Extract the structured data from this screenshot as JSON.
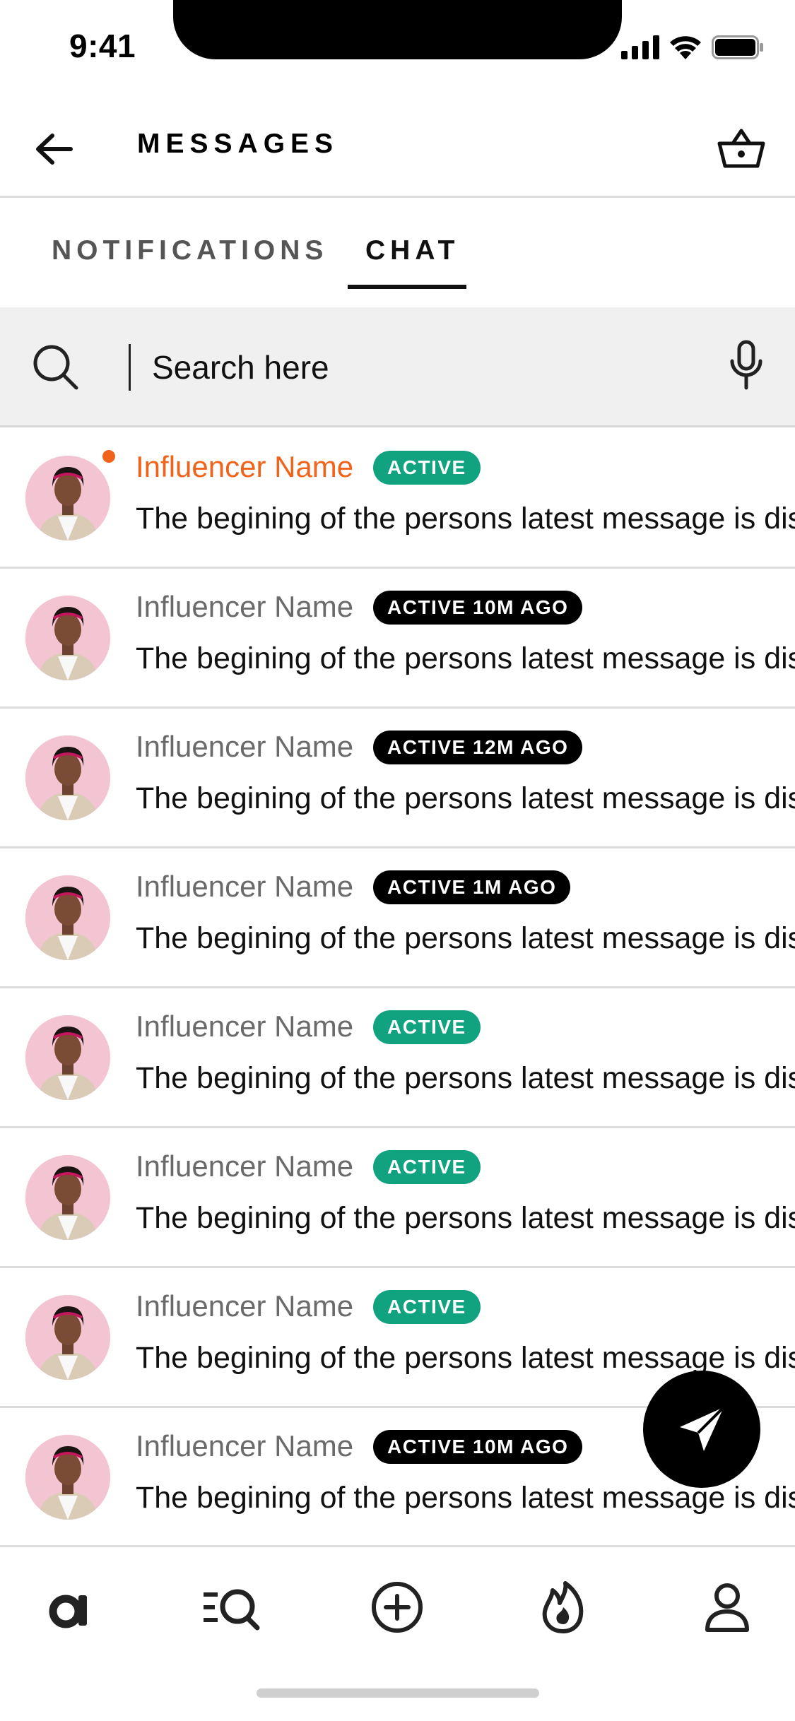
{
  "status_bar": {
    "time": "9:41"
  },
  "header": {
    "title": "MESSAGES"
  },
  "tabs": [
    {
      "label": "NOTIFICATIONS",
      "active": false
    },
    {
      "label": "CHAT",
      "active": true
    }
  ],
  "search": {
    "placeholder": "Search here",
    "value": ""
  },
  "colors": {
    "accent_orange": "#f0631a",
    "active_green": "#11a37f",
    "badge_black": "#000000"
  },
  "conversations": [
    {
      "name": "Influencer Name",
      "status": "ACTIVE",
      "status_color": "green",
      "preview": "The begining of the persons latest message is displayed here",
      "unread": true
    },
    {
      "name": "Influencer Name",
      "status": "ACTIVE 10M AGO",
      "status_color": "black",
      "preview": "The begining of the persons latest message is displayed here",
      "unread": false
    },
    {
      "name": "Influencer Name",
      "status": "ACTIVE 12M AGO",
      "status_color": "black",
      "preview": "The begining of the persons latest message is displayed here",
      "unread": false
    },
    {
      "name": "Influencer Name",
      "status": "ACTIVE 1M AGO",
      "status_color": "black",
      "preview": "The begining of the persons latest message is displayed here",
      "unread": false
    },
    {
      "name": "Influencer Name",
      "status": "ACTIVE",
      "status_color": "green",
      "preview": "The begining of the persons latest message is displayed here",
      "unread": false
    },
    {
      "name": "Influencer Name",
      "status": "ACTIVE",
      "status_color": "green",
      "preview": "The begining of the persons latest message is displayed here",
      "unread": false
    },
    {
      "name": "Influencer Name",
      "status": "ACTIVE",
      "status_color": "green",
      "preview": "The begining of the persons latest message is displayed here",
      "unread": false
    },
    {
      "name": "Influencer Name",
      "status": "ACTIVE 10M AGO",
      "status_color": "black",
      "preview": "The begining of the persons latest message is displayed here",
      "unread": false
    }
  ],
  "bottom_nav": [
    {
      "icon": "brand-a-icon"
    },
    {
      "icon": "search-list-icon"
    },
    {
      "icon": "add-circle-icon"
    },
    {
      "icon": "flame-icon"
    },
    {
      "icon": "profile-icon"
    }
  ]
}
